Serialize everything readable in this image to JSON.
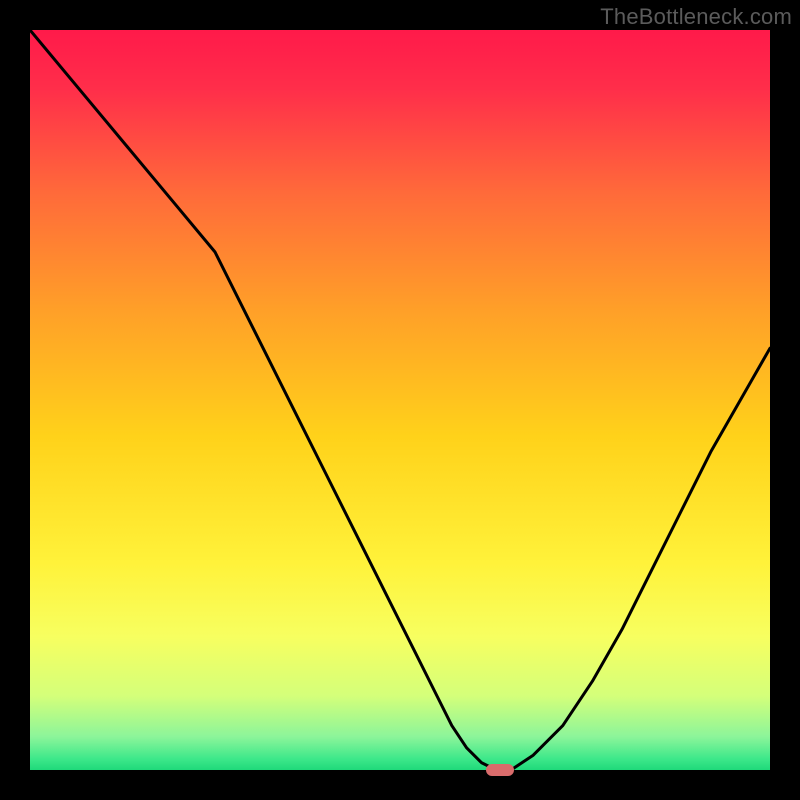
{
  "watermark": "TheBottleneck.com",
  "chart_data": {
    "type": "line",
    "title": "",
    "xlabel": "",
    "ylabel": "",
    "xlim": [
      0,
      100
    ],
    "ylim": [
      0,
      100
    ],
    "grid": false,
    "legend": false,
    "series": [
      {
        "name": "bottleneck-curve",
        "x": [
          0,
          5,
          10,
          15,
          20,
          25,
          28,
          32,
          36,
          40,
          44,
          48,
          52,
          55,
          57,
          59,
          61,
          63,
          65,
          68,
          72,
          76,
          80,
          84,
          88,
          92,
          96,
          100
        ],
        "y": [
          100,
          94,
          88,
          82,
          76,
          70,
          64,
          56,
          48,
          40,
          32,
          24,
          16,
          10,
          6,
          3,
          1,
          0,
          0,
          2,
          6,
          12,
          19,
          27,
          35,
          43,
          50,
          57
        ]
      }
    ],
    "bottleneck_marker": {
      "x": 63.5,
      "y": 0
    },
    "background_gradient": {
      "stops": [
        {
          "offset": 0,
          "color": "#ff1a4a"
        },
        {
          "offset": 0.08,
          "color": "#ff2e4a"
        },
        {
          "offset": 0.22,
          "color": "#ff6a3a"
        },
        {
          "offset": 0.38,
          "color": "#ffa028"
        },
        {
          "offset": 0.55,
          "color": "#ffd21a"
        },
        {
          "offset": 0.72,
          "color": "#fff23a"
        },
        {
          "offset": 0.82,
          "color": "#f7ff60"
        },
        {
          "offset": 0.9,
          "color": "#d4ff7a"
        },
        {
          "offset": 0.955,
          "color": "#8cf59a"
        },
        {
          "offset": 0.985,
          "color": "#3de88a"
        },
        {
          "offset": 1.0,
          "color": "#1fd97a"
        }
      ]
    }
  }
}
